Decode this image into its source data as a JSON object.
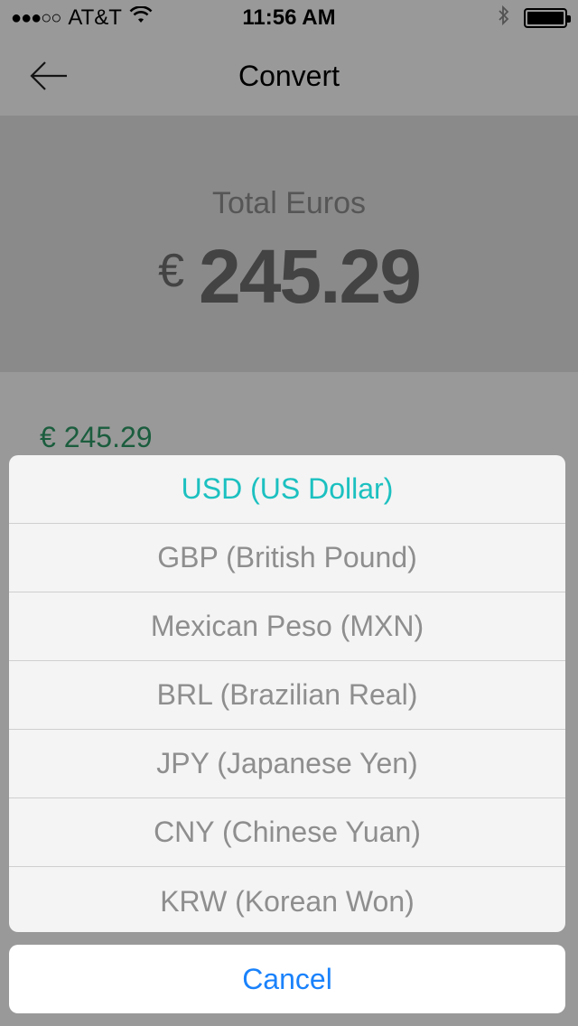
{
  "status_bar": {
    "carrier": "AT&T",
    "signal_dots": "●●●○○",
    "time": "11:56 AM",
    "battery_level": 1.0
  },
  "nav": {
    "title": "Convert"
  },
  "total": {
    "label": "Total Euros",
    "symbol": "€",
    "value": "245.29"
  },
  "converted": {
    "euro_text": "€ 245.29"
  },
  "action_sheet": {
    "options": [
      {
        "label": "USD (US Dollar)",
        "selected": true
      },
      {
        "label": "GBP (British Pound)",
        "selected": false
      },
      {
        "label": "Mexican Peso (MXN)",
        "selected": false
      },
      {
        "label": "BRL (Brazilian Real)",
        "selected": false
      },
      {
        "label": "JPY (Japanese Yen)",
        "selected": false
      },
      {
        "label": "CNY (Chinese Yuan)",
        "selected": false
      },
      {
        "label": "KRW (Korean Won)",
        "selected": false
      }
    ],
    "cancel_label": "Cancel"
  },
  "colors": {
    "accent_selected": "#1cc0c0",
    "cancel_blue": "#1a82fb",
    "euro_green": "#2d9c68"
  }
}
